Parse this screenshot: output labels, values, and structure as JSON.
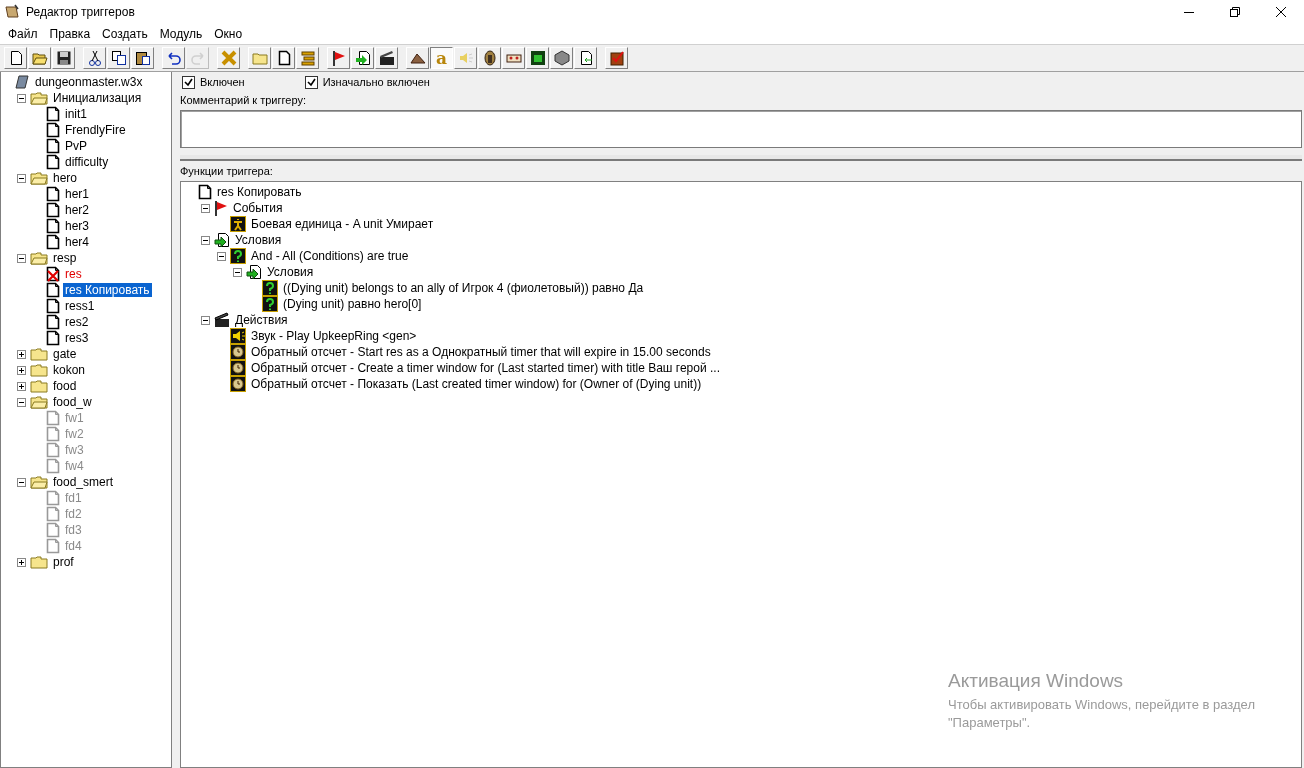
{
  "window": {
    "title": "Редактор триггеров"
  },
  "menu": [
    "Файл",
    "Правка",
    "Создать",
    "Модуль",
    "Окно"
  ],
  "toolbar": [
    [
      {
        "pressed": false,
        "disabled": false
      },
      {
        "pressed": false,
        "disabled": false
      },
      {
        "pressed": false,
        "disabled": false
      }
    ],
    [
      {
        "pressed": false,
        "disabled": false
      },
      {
        "pressed": false,
        "disabled": false
      },
      {
        "pressed": false,
        "disabled": false
      }
    ],
    [
      {
        "pressed": false,
        "disabled": false
      },
      {
        "pressed": false,
        "disabled": true
      }
    ],
    [
      {
        "pressed": false,
        "disabled": false
      }
    ],
    [
      {
        "pressed": false,
        "disabled": false
      },
      {
        "pressed": false,
        "disabled": false
      },
      {
        "pressed": false,
        "disabled": false
      }
    ],
    [
      {
        "pressed": false,
        "disabled": false
      },
      {
        "pressed": false,
        "disabled": false
      },
      {
        "pressed": false,
        "disabled": false
      }
    ],
    [
      {
        "pressed": false,
        "disabled": false
      },
      {
        "pressed": true,
        "disabled": false,
        "label": "a"
      },
      {
        "pressed": false,
        "disabled": false
      },
      {
        "pressed": false,
        "disabled": false
      },
      {
        "pressed": false,
        "disabled": false
      },
      {
        "pressed": false,
        "disabled": false
      },
      {
        "pressed": false,
        "disabled": false
      },
      {
        "pressed": false,
        "disabled": false
      }
    ],
    [
      {
        "pressed": false,
        "disabled": false
      }
    ]
  ],
  "sidebar": {
    "tree": {
      "kind": "map",
      "label": "dungeonmaster.w3x",
      "children": [
        {
          "kind": "folder",
          "label": "Инициализация",
          "expanded": true,
          "children": [
            {
              "kind": "trigger",
              "label": "init1",
              "selected": false,
              "disabled": false,
              "error": false
            },
            {
              "kind": "trigger",
              "label": "FrendlyFire",
              "selected": false,
              "disabled": false,
              "error": false
            },
            {
              "kind": "trigger",
              "label": "PvP",
              "selected": false,
              "disabled": false,
              "error": false
            },
            {
              "kind": "trigger",
              "label": "difficulty",
              "selected": false,
              "disabled": false,
              "error": false
            }
          ]
        },
        {
          "kind": "folder",
          "label": "hero",
          "expanded": true,
          "children": [
            {
              "kind": "trigger",
              "label": "her1",
              "selected": false,
              "disabled": false,
              "error": false
            },
            {
              "kind": "trigger",
              "label": "her2",
              "selected": false,
              "disabled": false,
              "error": false
            },
            {
              "kind": "trigger",
              "label": "her3",
              "selected": false,
              "disabled": false,
              "error": false
            },
            {
              "kind": "trigger",
              "label": "her4",
              "selected": false,
              "disabled": false,
              "error": false
            }
          ]
        },
        {
          "kind": "folder",
          "label": "resp",
          "expanded": true,
          "children": [
            {
              "kind": "trigger",
              "label": "res",
              "selected": false,
              "disabled": false,
              "error": true
            },
            {
              "kind": "trigger",
              "label": "res Копировать",
              "selected": true,
              "disabled": false,
              "error": false
            },
            {
              "kind": "trigger",
              "label": "ress1",
              "selected": false,
              "disabled": false,
              "error": false
            },
            {
              "kind": "trigger",
              "label": "res2",
              "selected": false,
              "disabled": false,
              "error": false
            },
            {
              "kind": "trigger",
              "label": "res3",
              "selected": false,
              "disabled": false,
              "error": false
            }
          ]
        },
        {
          "kind": "folder",
          "label": "gate",
          "expanded": false
        },
        {
          "kind": "folder",
          "label": "kokon",
          "expanded": false
        },
        {
          "kind": "folder",
          "label": "food",
          "expanded": false
        },
        {
          "kind": "folder",
          "label": "food_w",
          "expanded": true,
          "children": [
            {
              "kind": "trigger",
              "label": "fw1",
              "selected": false,
              "disabled": true,
              "error": false
            },
            {
              "kind": "trigger",
              "label": "fw2",
              "selected": false,
              "disabled": true,
              "error": false
            },
            {
              "kind": "trigger",
              "label": "fw3",
              "selected": false,
              "disabled": true,
              "error": false
            },
            {
              "kind": "trigger",
              "label": "fw4",
              "selected": false,
              "disabled": true,
              "error": false
            }
          ]
        },
        {
          "kind": "folder",
          "label": "food_smert",
          "expanded": true,
          "children": [
            {
              "kind": "trigger",
              "label": "fd1",
              "selected": false,
              "disabled": true,
              "error": false
            },
            {
              "kind": "trigger",
              "label": "fd2",
              "selected": false,
              "disabled": true,
              "error": false
            },
            {
              "kind": "trigger",
              "label": "fd3",
              "selected": false,
              "disabled": true,
              "error": false
            },
            {
              "kind": "trigger",
              "label": "fd4",
              "selected": false,
              "disabled": true,
              "error": false
            }
          ]
        },
        {
          "kind": "folder",
          "label": "prof",
          "expanded": false
        }
      ]
    }
  },
  "options": [
    {
      "label": "Включен",
      "checked": true
    },
    {
      "label": "Изначально включен",
      "checked": true
    }
  ],
  "comment": {
    "label": "Комментарий к триггеру:"
  },
  "functions": {
    "label": "Функции триггера:",
    "tree": {
      "kind": "trigger",
      "label": "res Копировать",
      "children": [
        {
          "kind": "events",
          "label": "События",
          "expanded": true,
          "children": [
            {
              "kind": "event",
              "label": "Боевая единица - A unit Умирает"
            }
          ]
        },
        {
          "kind": "conditions",
          "label": "Условия",
          "expanded": true,
          "children": [
            {
              "kind": "condition",
              "label": "And - All (Conditions) are true",
              "expanded": true,
              "children": [
                {
                  "kind": "conditions",
                  "label": "Условия",
                  "expanded": true,
                  "children": [
                    {
                      "kind": "condition",
                      "label": "((Dying unit) belongs to an ally of Игрок 4 (фиолетовый)) равно Да"
                    },
                    {
                      "kind": "condition",
                      "label": "(Dying unit) равно hero[0]"
                    }
                  ]
                }
              ]
            }
          ]
        },
        {
          "kind": "actions",
          "label": "Действия",
          "expanded": true,
          "children": [
            {
              "kind": "sound",
              "label": "Звук - Play UpkeepRing <gen>"
            },
            {
              "kind": "timer",
              "label": "Обратный отсчет - Start res as a Однократный timer that will expire in 15.00 seconds"
            },
            {
              "kind": "timer",
              "label": "Обратный отсчет - Create a timer window for (Last started timer) with title Ваш герой ..."
            },
            {
              "kind": "timer",
              "label": "Обратный отсчет - Показать (Last created timer window) for (Owner of (Dying unit))"
            }
          ]
        }
      ]
    }
  },
  "os_notice": {
    "title": "Активация Windows",
    "text": "Чтобы активировать Windows, перейдите в раздел \"Параметры\"."
  }
}
